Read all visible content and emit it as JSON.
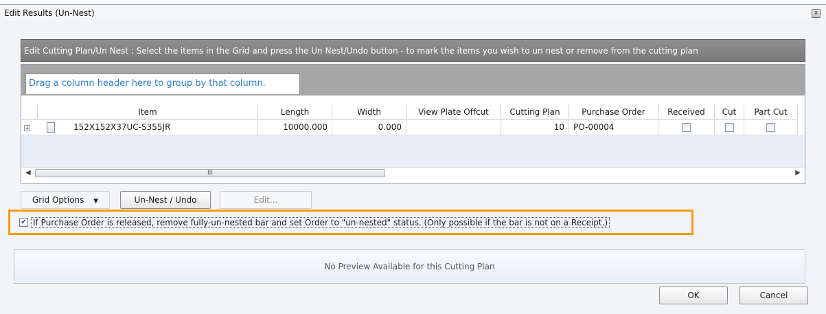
{
  "window": {
    "title": "Edit Results (Un-Nest)",
    "close_glyph": "x"
  },
  "instructions": "Edit Cutting Plan/Un Nest : Select the items in the Grid and press the Un Nest/Undo button - to mark the items you wish to un nest or remove from the cutting plan",
  "grid": {
    "group_hint": "Drag a column header here to group by that column.",
    "columns": [
      "Item",
      "Length",
      "Width",
      "View Plate Offcut",
      "Cutting Plan",
      "Purchase Order",
      "Received",
      "Cut",
      "Part Cut"
    ],
    "rows": [
      {
        "item": "152X152X37UC-S355JR",
        "length": "10000.000",
        "width": "0.000",
        "view_plate_offcut": "",
        "cutting_plan": "10",
        "purchase_order": "PO-00004",
        "received": false,
        "cut": false,
        "part_cut": false
      }
    ],
    "scroll_grip": "III"
  },
  "buttons": {
    "grid_options": "Grid Options",
    "un_nest": "Un-Nest / Undo",
    "edit": "Edit...",
    "ok": "OK",
    "cancel": "Cancel"
  },
  "option": {
    "checked": true,
    "label": "If Purchase Order is released, remove fully-un-nested bar and set Order to \"un-nested\" status. (Only possible if the bar is not on a Receipt.)"
  },
  "preview": {
    "text": "No Preview Available for this Cutting Plan"
  },
  "icons": {
    "expand": "plus-icon",
    "row": "document-icon",
    "dropdown": "chevron-down-icon"
  },
  "colors": {
    "highlight": "#f39c12",
    "link_blue": "#2a7fd4",
    "instruction_bar": "#838383"
  }
}
